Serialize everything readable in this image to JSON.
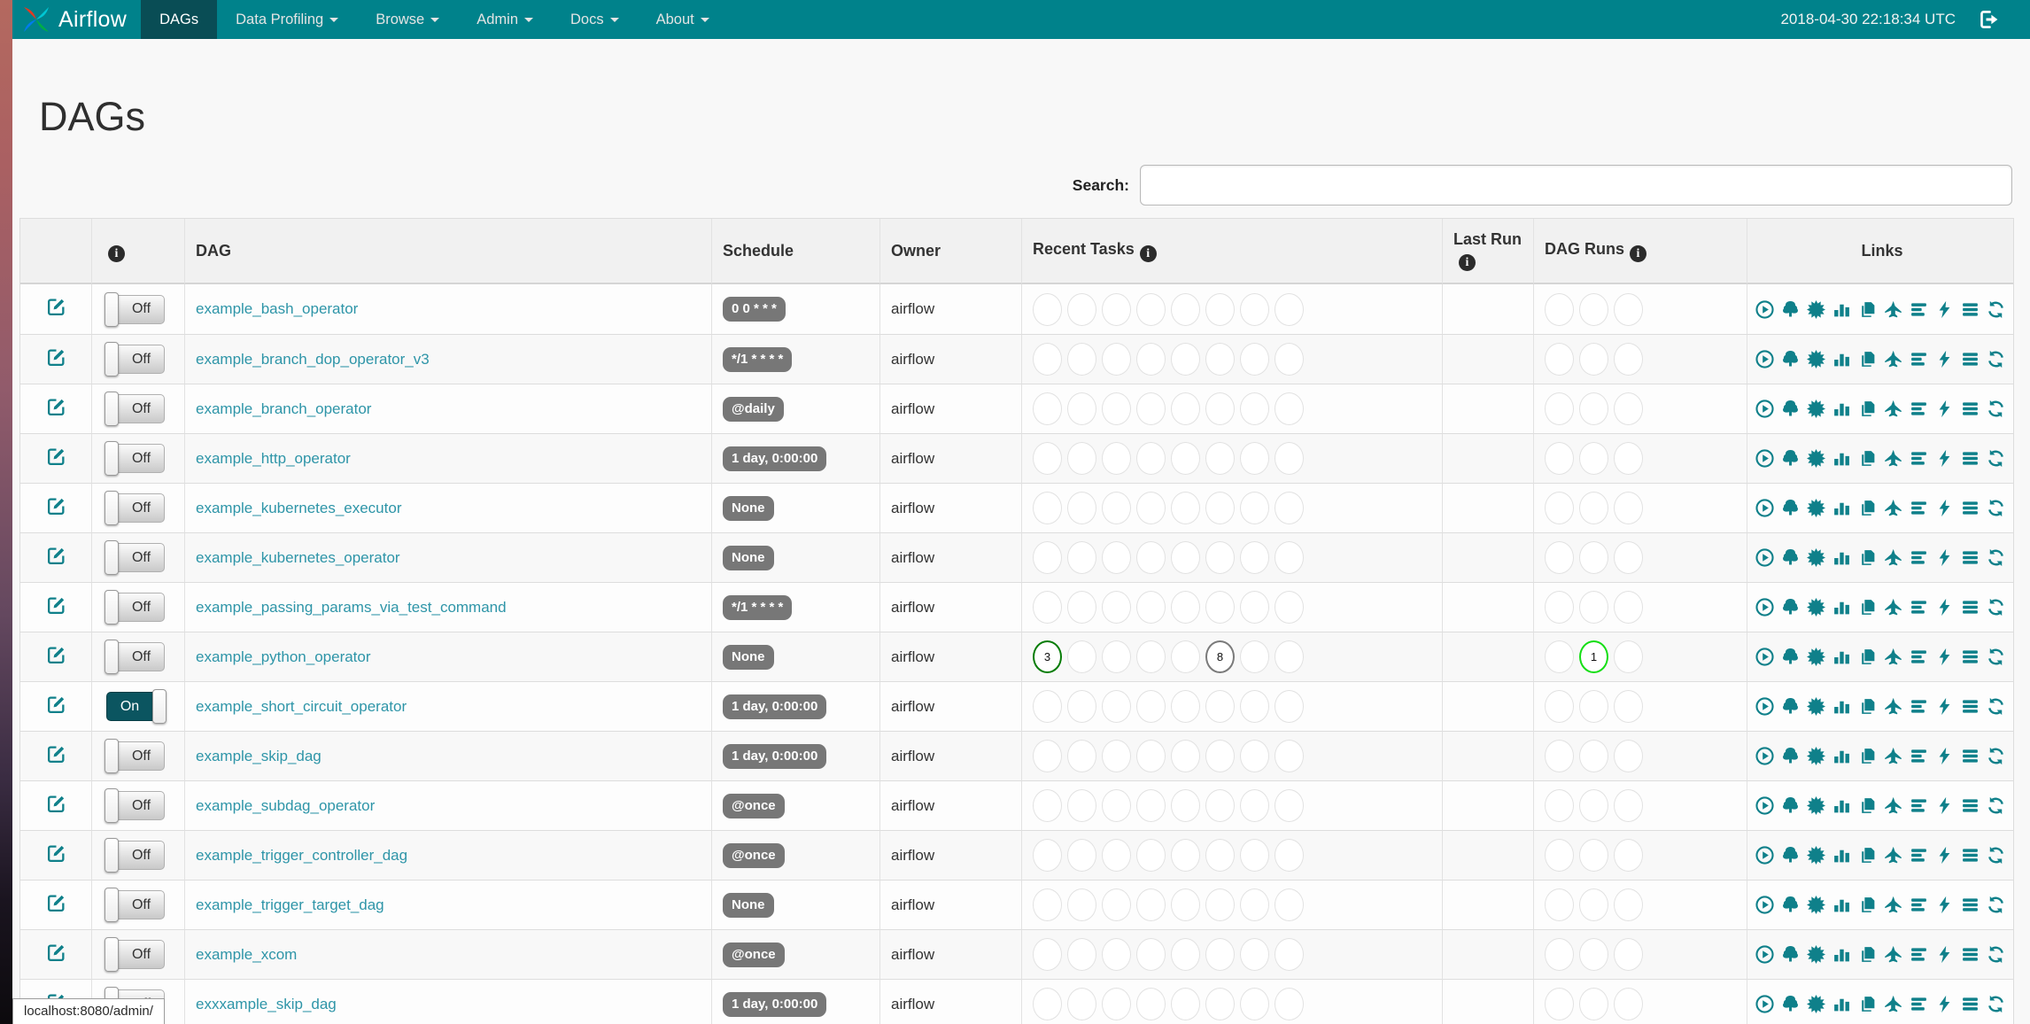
{
  "navbar": {
    "brand": "Airflow",
    "items": [
      {
        "label": "DAGs",
        "active": true,
        "caret": false
      },
      {
        "label": "Data Profiling",
        "active": false,
        "caret": true
      },
      {
        "label": "Browse",
        "active": false,
        "caret": true
      },
      {
        "label": "Admin",
        "active": false,
        "caret": true
      },
      {
        "label": "Docs",
        "active": false,
        "caret": true
      },
      {
        "label": "About",
        "active": false,
        "caret": true
      }
    ],
    "clock": "2018-04-30 22:18:34 UTC"
  },
  "page": {
    "title": "DAGs",
    "search_label": "Search:",
    "search_value": "",
    "status_bar": "localhost:8080/admin/"
  },
  "table": {
    "info_glyph": "i",
    "columns": [
      {
        "label": "",
        "info": false,
        "align": "left"
      },
      {
        "label": "",
        "info": true,
        "align": "left"
      },
      {
        "label": "DAG",
        "info": false,
        "align": "left"
      },
      {
        "label": "Schedule",
        "info": false,
        "align": "left"
      },
      {
        "label": "Owner",
        "info": false,
        "align": "left"
      },
      {
        "label": "Recent Tasks",
        "info": true,
        "align": "left"
      },
      {
        "label": "Last Run",
        "info": true,
        "align": "left"
      },
      {
        "label": "DAG Runs",
        "info": true,
        "align": "left"
      },
      {
        "label": "Links",
        "info": false,
        "align": "center"
      }
    ],
    "toggle": {
      "on_label": "On",
      "off_label": "Off"
    },
    "recent_task_slots": 8,
    "dag_run_slots": 3,
    "links_icons": [
      "trigger-dag",
      "tree-view",
      "graph-view",
      "task-duration",
      "task-tries",
      "landing-times",
      "gantt",
      "code-view",
      "dag-details",
      "refresh"
    ],
    "colors": {
      "navbar": "#00828B",
      "navbar_active": "#094D55",
      "link": "#2E95A8",
      "icon": "#0F808A",
      "badge": "#777777",
      "success": "#077D07",
      "running": "#15DE15",
      "queued": "#7A7A7A",
      "empty_border": "#E2E2E2"
    },
    "rows": [
      {
        "dag": "example_bash_operator",
        "schedule": "0 0 * * *",
        "owner": "airflow",
        "enabled": false,
        "recent_tasks": [],
        "dag_runs": []
      },
      {
        "dag": "example_branch_dop_operator_v3",
        "schedule": "*/1 * * * *",
        "owner": "airflow",
        "enabled": false,
        "recent_tasks": [],
        "dag_runs": []
      },
      {
        "dag": "example_branch_operator",
        "schedule": "@daily",
        "owner": "airflow",
        "enabled": false,
        "recent_tasks": [],
        "dag_runs": []
      },
      {
        "dag": "example_http_operator",
        "schedule": "1 day, 0:00:00",
        "owner": "airflow",
        "enabled": false,
        "recent_tasks": [],
        "dag_runs": []
      },
      {
        "dag": "example_kubernetes_executor",
        "schedule": "None",
        "owner": "airflow",
        "enabled": false,
        "recent_tasks": [],
        "dag_runs": []
      },
      {
        "dag": "example_kubernetes_operator",
        "schedule": "None",
        "owner": "airflow",
        "enabled": false,
        "recent_tasks": [],
        "dag_runs": []
      },
      {
        "dag": "example_passing_params_via_test_command",
        "schedule": "*/1 * * * *",
        "owner": "airflow",
        "enabled": false,
        "recent_tasks": [],
        "dag_runs": []
      },
      {
        "dag": "example_python_operator",
        "schedule": "None",
        "owner": "airflow",
        "enabled": false,
        "recent_tasks": [
          {
            "slot": 0,
            "count": "3",
            "state": "success"
          },
          {
            "slot": 5,
            "count": "8",
            "state": "queued"
          }
        ],
        "dag_runs": [
          {
            "slot": 1,
            "count": "1",
            "state": "running"
          }
        ]
      },
      {
        "dag": "example_short_circuit_operator",
        "schedule": "1 day, 0:00:00",
        "owner": "airflow",
        "enabled": true,
        "recent_tasks": [],
        "dag_runs": []
      },
      {
        "dag": "example_skip_dag",
        "schedule": "1 day, 0:00:00",
        "owner": "airflow",
        "enabled": false,
        "recent_tasks": [],
        "dag_runs": []
      },
      {
        "dag": "example_subdag_operator",
        "schedule": "@once",
        "owner": "airflow",
        "enabled": false,
        "recent_tasks": [],
        "dag_runs": []
      },
      {
        "dag": "example_trigger_controller_dag",
        "schedule": "@once",
        "owner": "airflow",
        "enabled": false,
        "recent_tasks": [],
        "dag_runs": []
      },
      {
        "dag": "example_trigger_target_dag",
        "schedule": "None",
        "owner": "airflow",
        "enabled": false,
        "recent_tasks": [],
        "dag_runs": []
      },
      {
        "dag": "example_xcom",
        "schedule": "@once",
        "owner": "airflow",
        "enabled": false,
        "recent_tasks": [],
        "dag_runs": []
      },
      {
        "dag": "exxxample_skip_dag",
        "schedule": "1 day, 0:00:00",
        "owner": "airflow",
        "enabled": false,
        "recent_tasks": [],
        "dag_runs": []
      }
    ]
  }
}
